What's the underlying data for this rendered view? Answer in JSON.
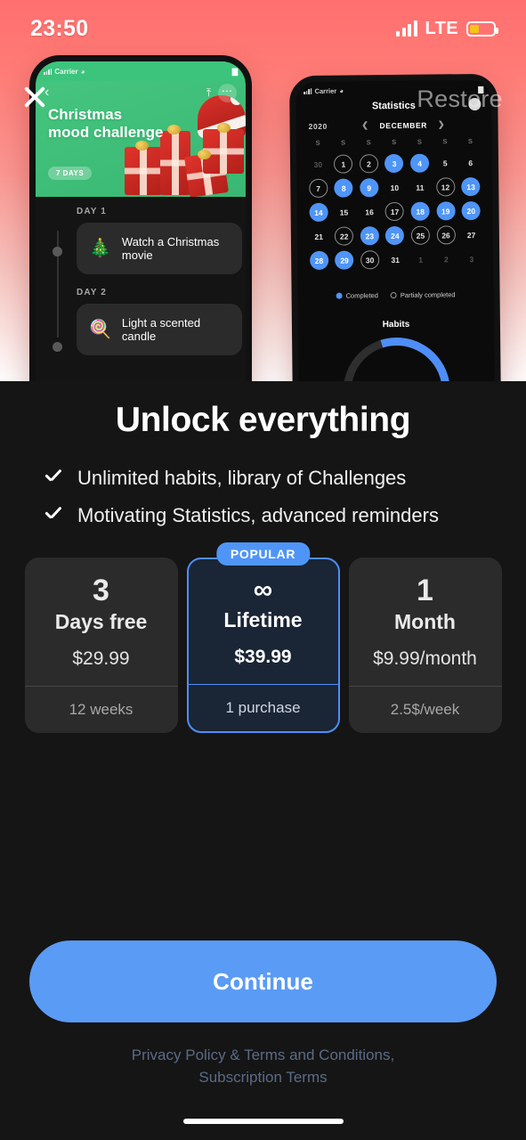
{
  "status_bar": {
    "time": "23:50",
    "network": "LTE",
    "signal_icon": "cellular-signal-icon",
    "battery_icon": "battery-icon"
  },
  "hero": {
    "close_icon": "close-icon",
    "restore_label": "Restore",
    "left_phone": {
      "carrier": "Carrier",
      "back_icon": "chevron-left-icon",
      "share_icon": "share-icon",
      "more_icon": "more-options-icon",
      "challenge_title": "Christmas mood challenge",
      "duration_badge": "7 DAYS",
      "days": [
        {
          "label": "DAY 1",
          "emoji": "🎄",
          "emoji_name": "christmas-tree-emoji",
          "task": "Watch a Christmas movie"
        },
        {
          "label": "DAY 2",
          "emoji": "🍭",
          "emoji_name": "candy-cane-emoji",
          "task": "Light a scented candle"
        }
      ]
    },
    "right_phone": {
      "carrier": "Carrier",
      "screen_title": "Statistics",
      "year": "2020",
      "month": "DECEMBER",
      "prev_icon": "chevron-left-icon",
      "next_icon": "chevron-right-icon",
      "weekday_headers": [
        "S",
        "S",
        "S",
        "S",
        "S",
        "S",
        "S"
      ],
      "days": [
        {
          "n": "30",
          "state": "muted"
        },
        {
          "n": "1",
          "state": "partial"
        },
        {
          "n": "2",
          "state": "partial"
        },
        {
          "n": "3",
          "state": "completed"
        },
        {
          "n": "4",
          "state": "completed"
        },
        {
          "n": "5",
          "state": "none"
        },
        {
          "n": "6",
          "state": "none"
        },
        {
          "n": "7",
          "state": "partial"
        },
        {
          "n": "8",
          "state": "completed"
        },
        {
          "n": "9",
          "state": "completed"
        },
        {
          "n": "10",
          "state": "none"
        },
        {
          "n": "11",
          "state": "none"
        },
        {
          "n": "12",
          "state": "partial"
        },
        {
          "n": "13",
          "state": "completed"
        },
        {
          "n": "14",
          "state": "completed"
        },
        {
          "n": "15",
          "state": "none"
        },
        {
          "n": "16",
          "state": "none"
        },
        {
          "n": "17",
          "state": "partial"
        },
        {
          "n": "18",
          "state": "completed"
        },
        {
          "n": "19",
          "state": "completed"
        },
        {
          "n": "20",
          "state": "completed"
        },
        {
          "n": "21",
          "state": "none"
        },
        {
          "n": "22",
          "state": "partial"
        },
        {
          "n": "23",
          "state": "completed"
        },
        {
          "n": "24",
          "state": "completed"
        },
        {
          "n": "25",
          "state": "partial"
        },
        {
          "n": "26",
          "state": "partial"
        },
        {
          "n": "27",
          "state": "none"
        },
        {
          "n": "28",
          "state": "completed"
        },
        {
          "n": "29",
          "state": "completed"
        },
        {
          "n": "30",
          "state": "partial"
        },
        {
          "n": "31",
          "state": "none"
        },
        {
          "n": "1",
          "state": "muted"
        },
        {
          "n": "2",
          "state": "muted"
        },
        {
          "n": "3",
          "state": "muted"
        }
      ],
      "legend": [
        {
          "label": "Completed",
          "type": "dot"
        },
        {
          "label": "Partialy completed",
          "type": "ring"
        }
      ],
      "habits_title": "Habits"
    }
  },
  "paywall": {
    "headline": "Unlock everything",
    "features": [
      {
        "icon": "check-icon",
        "text": "Unlimited habits, library of Challenges"
      },
      {
        "icon": "check-icon",
        "text": "Motivating Statistics, advanced reminders"
      }
    ],
    "plans": [
      {
        "badge": "",
        "number": "3",
        "unit": "Days free",
        "price": "$29.99",
        "footer": "12 weeks",
        "featured": false
      },
      {
        "badge": "POPULAR",
        "number": "∞",
        "unit": "Lifetime",
        "price": "$39.99",
        "footer": "1 purchase",
        "featured": true
      },
      {
        "badge": "",
        "number": "1",
        "unit": "Month",
        "price": "$9.99/month",
        "footer": "2.5$/week",
        "featured": false
      }
    ],
    "continue_label": "Continue",
    "legal": {
      "privacy": "Privacy Policy",
      "separator": " & ",
      "terms": "Terms and Conditions,",
      "subscription": "Subscription Terms"
    }
  },
  "colors": {
    "accent_blue": "#4f95f7",
    "button_blue": "#5a9bf6",
    "card_bg": "#2b2b2b",
    "featured_card_bg": "#1a2535",
    "page_bg": "#151515",
    "hero_gradient_top": "#ff6f6f",
    "hero_gradient_bottom": "#ffffff",
    "battery_yellow": "#f5c518",
    "legal_link": "#5b6b86"
  }
}
